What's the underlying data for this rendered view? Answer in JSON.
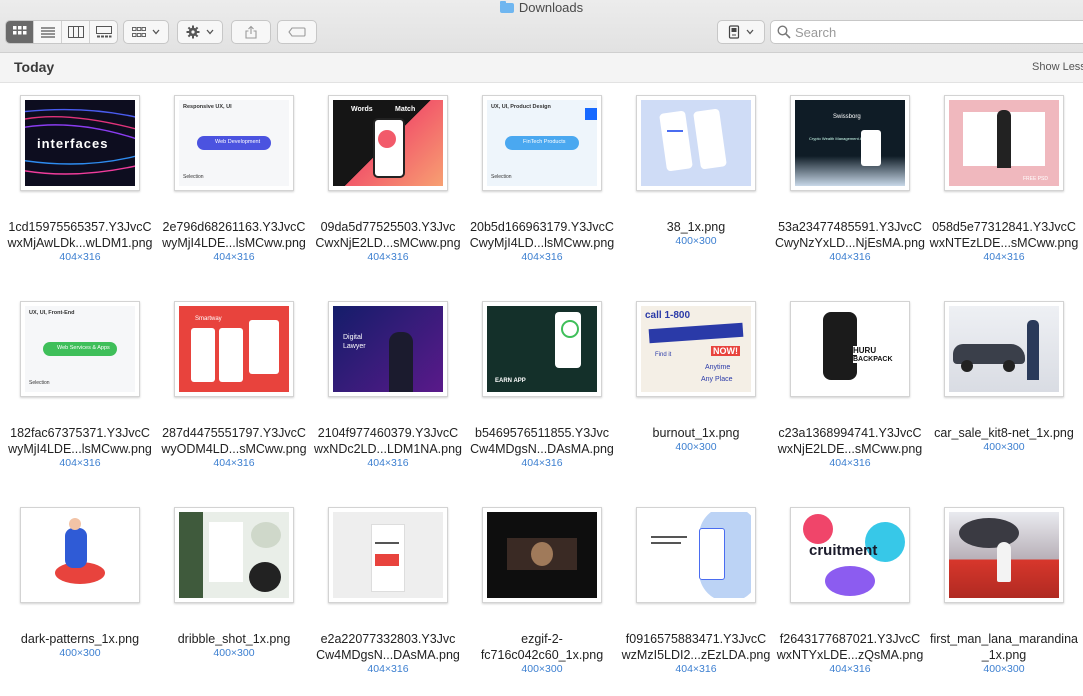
{
  "window": {
    "title": "Downloads"
  },
  "toolbar": {
    "view_modes": [
      "icon-view",
      "list-view",
      "column-view",
      "gallery-view"
    ],
    "search_placeholder": "Search"
  },
  "section": {
    "title": "Today",
    "toggle": "Show Less"
  },
  "files": [
    {
      "line1": "1cd15975565357.Y3JvcC",
      "line2": "wxMjAwLDk...wLDM1.png",
      "dims": "404×316"
    },
    {
      "line1": "2e796d68261163.Y3JvcC",
      "line2": "wyMjI4LDE...lsMCww.png",
      "dims": "404×316"
    },
    {
      "line1": "09da5d77525503.Y3Jvc",
      "line2": "CwxNjE2LD...sMCww.png",
      "dims": "404×316"
    },
    {
      "line1": "20b5d166963179.Y3JvcC",
      "line2": "CwyMjI4LD...lsMCww.png",
      "dims": "404×316"
    },
    {
      "line1": "38_1x.png",
      "line2": "",
      "dims": "400×300"
    },
    {
      "line1": "53a23477485591.Y3JvcC",
      "line2": "CwyNzYxLD...NjEsMA.png",
      "dims": "404×316"
    },
    {
      "line1": "058d5e77312841.Y3JvcC",
      "line2": "wxNTEzLDE...sMCww.png",
      "dims": "404×316"
    },
    {
      "line1": "182fac67375371.Y3JvcC",
      "line2": "wyMjI4LDE...lsMCww.png",
      "dims": "404×316"
    },
    {
      "line1": "287d4475551797.Y3JvcC",
      "line2": "wyODM4LD...sMCww.png",
      "dims": "404×316"
    },
    {
      "line1": "2104f977460379.Y3JvcC",
      "line2": "wxNDc2LD...LDM1NA.png",
      "dims": "404×316"
    },
    {
      "line1": "b5469576511855.Y3Jvc",
      "line2": "Cw4MDgsN...DAsMA.png",
      "dims": "404×316"
    },
    {
      "line1": "burnout_1x.png",
      "line2": "",
      "dims": "400×300"
    },
    {
      "line1": "c23a1368994741.Y3JvcC",
      "line2": "wxNjE2LDE...sMCww.png",
      "dims": "404×316"
    },
    {
      "line1": "car_sale_kit8-net_1x.png",
      "line2": "",
      "dims": "400×300"
    },
    {
      "line1": "dark-patterns_1x.png",
      "line2": "",
      "dims": "400×300"
    },
    {
      "line1": "dribble_shot_1x.png",
      "line2": "",
      "dims": "400×300"
    },
    {
      "line1": "e2a22077332803.Y3Jvc",
      "line2": "Cw4MDgsN...DAsMA.png",
      "dims": "404×316"
    },
    {
      "line1": "ezgif-2-",
      "line2": "fc716c042c60_1x.png",
      "dims": "400×300"
    },
    {
      "line1": "f0916575883471.Y3JvcC",
      "line2": "wzMzI5LDI2...zEzLDA.png",
      "dims": "404×316"
    },
    {
      "line1": "f2643177687021.Y3JvcC",
      "line2": "wxNTYxLDE...zQsMA.png",
      "dims": "404×316"
    },
    {
      "line1": "first_man_lana_marandina",
      "line2": "_1x.png",
      "dims": "400×300"
    }
  ],
  "thumb_text": {
    "t1": "interfaces",
    "t2_head": "Responsive UX, UI",
    "t2_btn": "Web Development",
    "t2_foot": "Selection",
    "t3_a": "Words",
    "t3_b": "Match",
    "t4_head": "UX, UI, Product Design",
    "t4_btn": "FinTech Products",
    "t4_foot": "Selection",
    "t6_a": "Swissborg",
    "t6_b": "Crypto Wealth Management App",
    "t8_head": "UX, UI, Front-End",
    "t8_btn": "Web Services & Apps",
    "t8_foot": "Selection",
    "t9": "Smartway",
    "t10_a": "Digital",
    "t10_b": "Lawyer",
    "t11": "EARN APP",
    "t12_a": "call 1-800",
    "t12_b": "NOW!",
    "t12_c": "Find it",
    "t12_d": "Anytime",
    "t12_e": "Any Place",
    "t13_a": "HURU",
    "t13_b": "BACKPACK",
    "t20": "cruitment",
    "t7": "FREE PSD"
  }
}
